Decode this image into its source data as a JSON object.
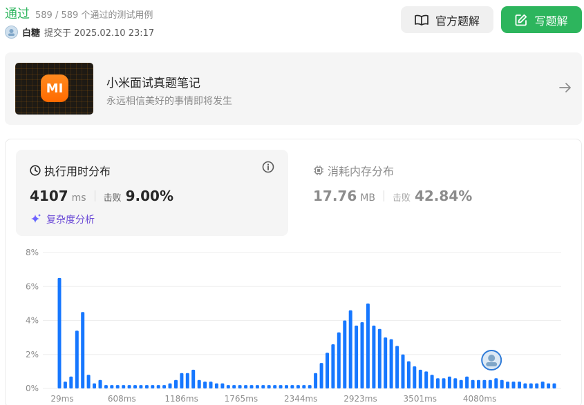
{
  "header": {
    "status": "通过",
    "cases": "589 / 589 个通过的测试用例",
    "user": "白糖",
    "submitted": "提交于 2025.02.10 23:17",
    "official_button": "官方题解",
    "write_button": "写题解"
  },
  "banner": {
    "logo_text": "MI",
    "title": "小米面试真题笔记",
    "subtitle": "永远相信美好的事情即将发生"
  },
  "runtime": {
    "title": "执行用时分布",
    "value": "4107",
    "unit": "ms",
    "beat_label": "击败",
    "beat_value": "9.00%",
    "complexity": "复杂度分析"
  },
  "memory": {
    "title": "消耗内存分布",
    "value": "17.76",
    "unit": "MB",
    "beat_label": "击败",
    "beat_value": "42.84%"
  },
  "colors": {
    "accent_green": "#2db55d",
    "bar_blue": "#1677ff"
  },
  "chart_data": {
    "type": "bar",
    "ylim": [
      0,
      8
    ],
    "y_ticks": [
      "0%",
      "2%",
      "4%",
      "6%",
      "8%"
    ],
    "x_tick_labels": [
      "29ms",
      "608ms",
      "1186ms",
      "1765ms",
      "2344ms",
      "2923ms",
      "3501ms",
      "4080ms"
    ],
    "grid": true,
    "values": [
      6.5,
      0.4,
      0.7,
      3.4,
      4.5,
      0.8,
      0.3,
      0.5,
      0.2,
      0.2,
      0.2,
      0.2,
      0.2,
      0.2,
      0.2,
      0.2,
      0.2,
      0.2,
      0.2,
      0.3,
      0.5,
      0.9,
      0.9,
      1.1,
      0.5,
      0.4,
      0.4,
      0.3,
      0.3,
      0.2,
      0.2,
      0.2,
      0.2,
      0.2,
      0.2,
      0.2,
      0.2,
      0.2,
      0.2,
      0.2,
      0.2,
      0.2,
      0.2,
      0.2,
      0.9,
      1.5,
      2.1,
      2.6,
      3.3,
      4.0,
      4.6,
      3.7,
      3.9,
      5.0,
      3.7,
      3.5,
      3.0,
      2.9,
      2.5,
      2.0,
      1.6,
      1.3,
      1.1,
      1.0,
      0.8,
      0.6,
      0.6,
      0.7,
      0.6,
      0.5,
      0.7,
      0.5,
      0.5,
      0.5,
      0.5,
      0.6,
      0.5,
      0.4,
      0.4,
      0.4,
      0.3,
      0.3,
      0.3,
      0.4,
      0.3,
      0.3
    ],
    "highlight_index": 76
  }
}
